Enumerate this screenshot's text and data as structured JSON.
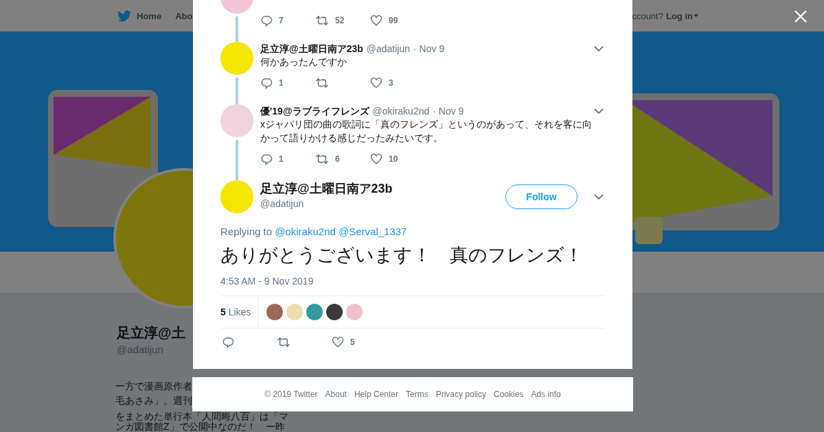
{
  "nav": {
    "home": "Home",
    "about": "Abo",
    "account": "ccount?",
    "login": "Log in"
  },
  "profile": {
    "name": "足立淳@土",
    "handle": "@adatijun",
    "bio_lines": [
      "一方で漫画原作者",
      "毛あさみ」。週刊",
      "をまとめた単行本「人間晦八百」は「マ",
      "ンガ図書館Z」で公開中なのだ！　一昨"
    ]
  },
  "thread": [
    {
      "kind": "partial",
      "replies": "7",
      "retweets": "52",
      "likes": "99"
    },
    {
      "kind": "reply",
      "name": "足立淳@土曜日南ア23b",
      "handle": "@adatijun",
      "date": "· Nov 9",
      "text": "何かあったんですか",
      "replies": "1",
      "likes": "3"
    },
    {
      "kind": "reply",
      "name": "優'19@ラブライフレンズ",
      "handle": "@okiraku2nd",
      "date": "· Nov 9",
      "text": "xジャパリ団の曲の歌詞に「真のフレンズ」というのがあって、それを客に向かって語りかける感じだったみたいです。",
      "replies": "1",
      "retweets": "6",
      "likes": "10"
    }
  ],
  "main_tweet": {
    "name": "足立淳@土曜日南ア23b",
    "handle": "@adatijun",
    "follow": "Follow",
    "replying_label": "Replying to",
    "replying_to": [
      "@okiraku2nd",
      "@Serval_1337"
    ],
    "text": "ありがとうございます！　真のフレンズ！",
    "timestamp": "4:53 AM - 9 Nov 2019",
    "likes_count": "5",
    "likes_label": "Likes",
    "likes": "5"
  },
  "footer": [
    "© 2019 Twitter",
    "About",
    "Help Center",
    "Terms",
    "Privacy policy",
    "Cookies",
    "Ads info"
  ]
}
